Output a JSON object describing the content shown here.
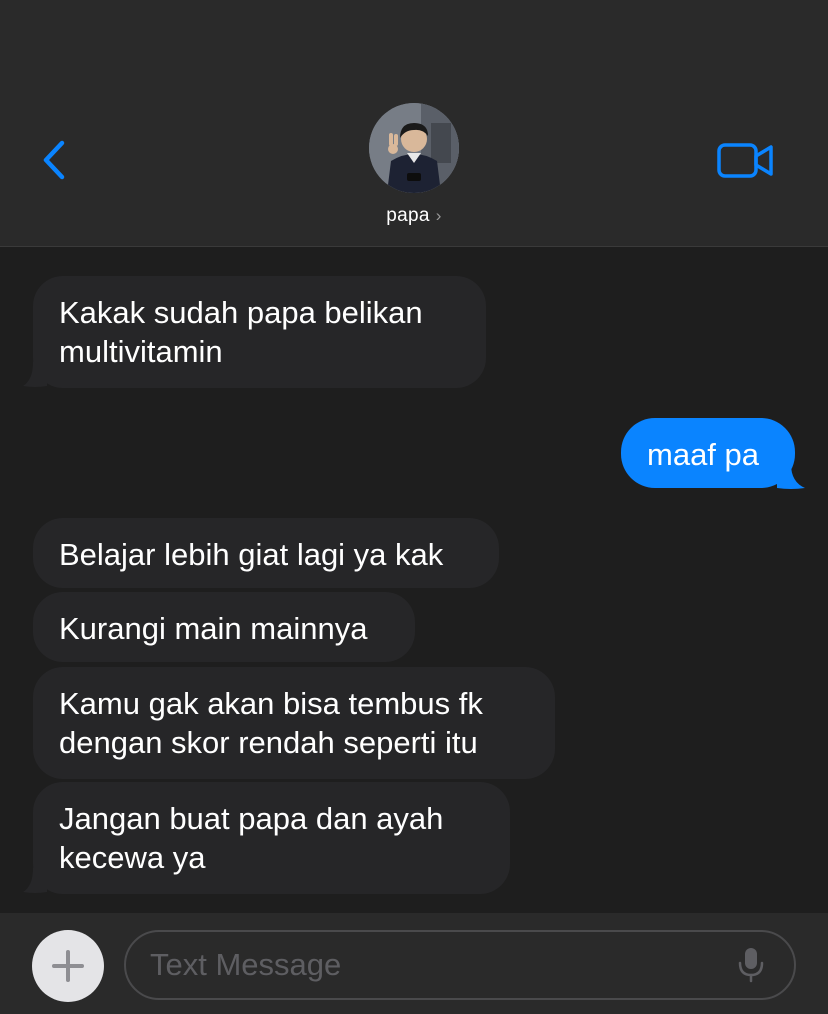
{
  "header": {
    "contact_name": "papa",
    "chevron": "›",
    "avatar_icon": "person-peace-sign-photo",
    "back_icon": "chevron-left-icon",
    "video_icon": "video-camera-icon"
  },
  "messages": [
    {
      "direction": "incoming",
      "text": "Kakak sudah papa belikan multivitamin"
    },
    {
      "direction": "outgoing",
      "text": "maaf pa"
    },
    {
      "direction": "incoming",
      "text": "Belajar lebih giat lagi ya kak"
    },
    {
      "direction": "incoming",
      "text": "Kurangi main mainnya"
    },
    {
      "direction": "incoming",
      "text": "Kamu gak akan bisa tembus fk dengan skor rendah seperti itu"
    },
    {
      "direction": "incoming",
      "text": "Jangan buat papa dan ayah kecewa ya"
    }
  ],
  "composer": {
    "placeholder": "Text Message",
    "value": "",
    "plus_icon": "plus-icon",
    "mic_icon": "microphone-icon"
  },
  "colors": {
    "accent": "#0a84ff",
    "incoming_bubble": "#262628",
    "background": "#1e1e1e",
    "header_background": "#2a2a2a"
  }
}
